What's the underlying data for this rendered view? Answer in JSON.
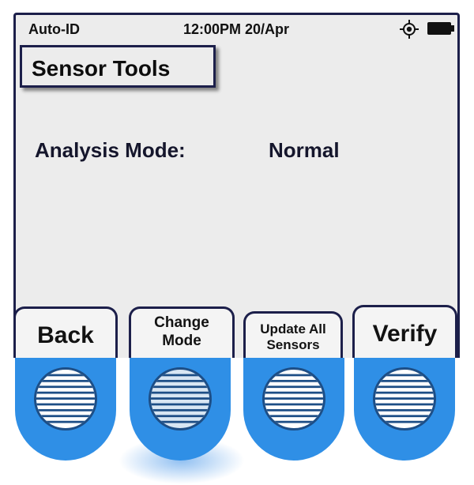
{
  "status_bar": {
    "mode": "Auto-ID",
    "datetime": "12:00PM 20/Apr",
    "gps_icon": "gps-target-icon",
    "battery_icon": "battery-full-icon"
  },
  "screen": {
    "title": "Sensor Tools",
    "analysis_mode_label": "Analysis Mode:",
    "analysis_mode_value": "Normal"
  },
  "softkeys": {
    "back": "Back",
    "change_mode": [
      "Change",
      "Mode"
    ],
    "update_all": [
      "Update All",
      "Sensors"
    ],
    "verify": "Verify"
  },
  "colors": {
    "screen_border": "#1c1f4a",
    "hardware_button": "#2f8fe6"
  }
}
